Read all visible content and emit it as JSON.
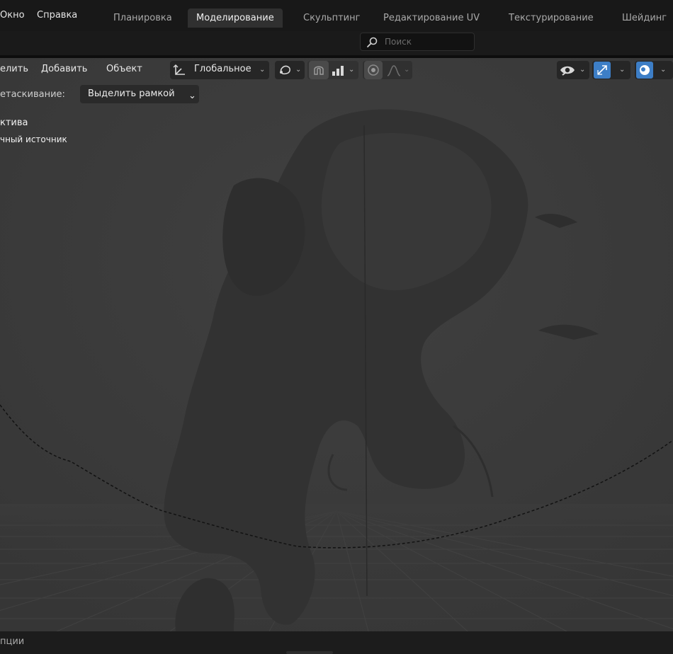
{
  "menu": {
    "window": "Окно",
    "help": "Справка"
  },
  "workspaces": {
    "tabs": [
      {
        "label": "Планировка",
        "active": false
      },
      {
        "label": "Моделирование",
        "active": true
      },
      {
        "label": "Скульптинг",
        "active": false
      },
      {
        "label": "Редактирование UV",
        "active": false
      },
      {
        "label": "Текстурирование",
        "active": false
      },
      {
        "label": "Шейдинг",
        "active": false
      }
    ]
  },
  "search": {
    "placeholder": "Поиск",
    "icon": "search-icon"
  },
  "viewport_header": {
    "menus": {
      "select": "елить",
      "add": "Добавить",
      "object": "Объект"
    },
    "orientation": "Глобальное",
    "icons": {
      "transform": "transform-orientation-icon",
      "pivot": "pivot-point-icon",
      "snap": "snap-magnet-icon",
      "snap_target": "snap-increment-icon",
      "proportional": "proportional-editing-icon",
      "falloff": "falloff-curve-icon",
      "visibility": "visibility-eye-icon",
      "gizmo": "gizmo-icon",
      "overlays": "overlays-icon"
    }
  },
  "tool_settings": {
    "drag_label": "етаскивание:",
    "drag_value": "Выделить рамкой"
  },
  "viewport_info": {
    "view_name": "ктива",
    "object_name": "чный источник"
  },
  "status_bar": {
    "text": "пции"
  },
  "colors": {
    "accent_blue": "#3d7ec6",
    "viewport_bg": "#3b3b3b",
    "active_tab": "#303030"
  }
}
